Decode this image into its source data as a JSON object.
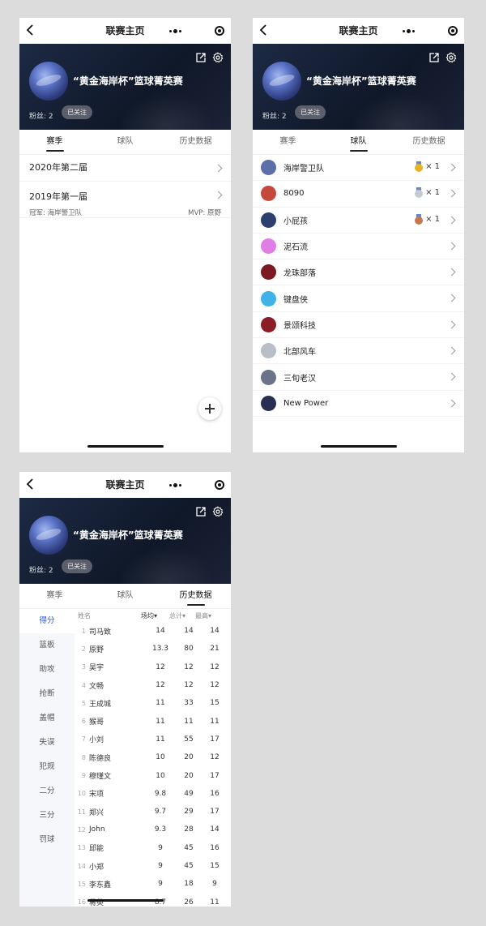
{
  "nav": {
    "title": "联赛主页"
  },
  "league": {
    "name": "“黄金海岸杯”篮球菁英赛",
    "fans": "粉丝: 2",
    "follow_label": "已关注"
  },
  "tabs": [
    "赛季",
    "球队",
    "历史数据"
  ],
  "seasons": [
    {
      "name": "2020年第二届"
    },
    {
      "name": "2019年第一届",
      "champion": "冠军: 海岸警卫队",
      "mvp": "MVP: 原野"
    }
  ],
  "teams": [
    {
      "name": "海岸警卫队",
      "medal": "gold",
      "count": "× 1",
      "avatar_color": "#5b6fa8"
    },
    {
      "name": "8090",
      "medal": "silver",
      "count": "× 1",
      "avatar_color": "#c6483a"
    },
    {
      "name": "小屁孩",
      "medal": "bronze",
      "count": "× 1",
      "avatar_color": "#2d3f6e"
    },
    {
      "name": "泥石流",
      "avatar_color": "#e07ee6"
    },
    {
      "name": "龙珠部落",
      "avatar_color": "#7a1a22"
    },
    {
      "name": "键盘侠",
      "avatar_color": "#3fb3e8"
    },
    {
      "name": "景颂科技",
      "avatar_color": "#8b1d26"
    },
    {
      "name": "北部风车",
      "avatar_color": "#b9bfc7"
    },
    {
      "name": "三旬老汉",
      "avatar_color": "#6b7388"
    },
    {
      "name": "New Power",
      "avatar_color": "#2a2f52"
    }
  ],
  "colors": {
    "gold": "#e6b422",
    "silver": "#c5cbd3",
    "bronze": "#c2794d",
    "accent": "#2c54c4"
  },
  "history": {
    "categories": [
      "得分",
      "篮板",
      "助攻",
      "抢断",
      "盖帽",
      "失误",
      "犯规",
      "二分",
      "三分",
      "罚球"
    ],
    "headers": {
      "name": "姓名",
      "avg": "场均▾",
      "total": "总计▾",
      "max": "最高▾"
    },
    "rows": [
      {
        "rank": "1",
        "name": "司马致",
        "avg": "14",
        "total": "14",
        "max": "14"
      },
      {
        "rank": "2",
        "name": "原野",
        "avg": "13.3",
        "total": "80",
        "max": "21"
      },
      {
        "rank": "3",
        "name": "吴宇",
        "avg": "12",
        "total": "12",
        "max": "12"
      },
      {
        "rank": "4",
        "name": "文畅",
        "avg": "12",
        "total": "12",
        "max": "12"
      },
      {
        "rank": "5",
        "name": "王成城",
        "avg": "11",
        "total": "33",
        "max": "15"
      },
      {
        "rank": "6",
        "name": "猴哥",
        "avg": "11",
        "total": "11",
        "max": "11"
      },
      {
        "rank": "7",
        "name": "小刘",
        "avg": "11",
        "total": "55",
        "max": "17"
      },
      {
        "rank": "8",
        "name": "陈德良",
        "avg": "10",
        "total": "20",
        "max": "12"
      },
      {
        "rank": "9",
        "name": "穆瑾文",
        "avg": "10",
        "total": "20",
        "max": "17"
      },
      {
        "rank": "10",
        "name": "宋项",
        "avg": "9.8",
        "total": "49",
        "max": "16"
      },
      {
        "rank": "11",
        "name": "郑兴",
        "avg": "9.7",
        "total": "29",
        "max": "17"
      },
      {
        "rank": "12",
        "name": "John",
        "avg": "9.3",
        "total": "28",
        "max": "14"
      },
      {
        "rank": "13",
        "name": "邱能",
        "avg": "9",
        "total": "45",
        "max": "16"
      },
      {
        "rank": "14",
        "name": "小郑",
        "avg": "9",
        "total": "45",
        "max": "15"
      },
      {
        "rank": "15",
        "name": "李东鑫",
        "avg": "9",
        "total": "18",
        "max": "9"
      },
      {
        "rank": "16",
        "name": "蒋英",
        "avg": "8.7",
        "total": "26",
        "max": "11"
      }
    ]
  }
}
